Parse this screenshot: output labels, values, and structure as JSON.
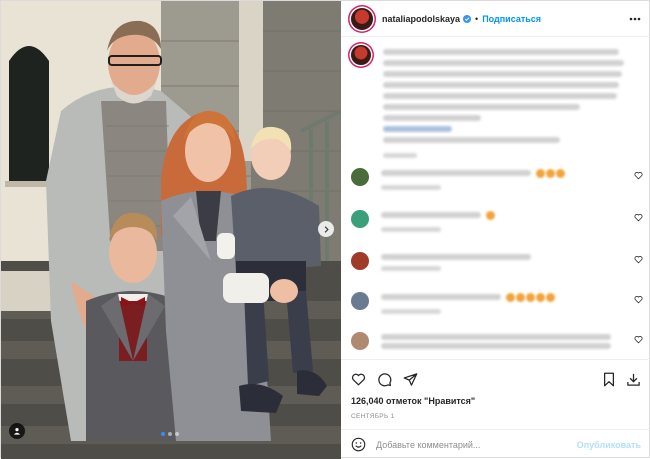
{
  "post": {
    "username": "nataliapodolskaya",
    "separator": "•",
    "follow_label": "Подписаться",
    "caption_lines": 9,
    "likes": "126,040 отметок \"Нравится\"",
    "date": "СЕНТЯБРЬ 1"
  },
  "comments": [
    {
      "avatar_color": "#4a6b3a",
      "emoji_count": 3
    },
    {
      "avatar_color": "#3aa07a",
      "emoji_count": 1
    },
    {
      "avatar_color": "#a03a2a",
      "emoji_count": 0
    },
    {
      "avatar_color": "#6a7a90",
      "emoji_count": 5
    },
    {
      "avatar_color": "#b08a70",
      "emoji_count": 0
    }
  ],
  "composer": {
    "placeholder": "Добавьте комментарий...",
    "publish_label": "Опубликовать"
  },
  "carousel": {
    "slide_count": 3,
    "active_index": 0
  },
  "colors": {
    "accent": "#0095f6",
    "story_ring": "#d1226e",
    "publish_disabled": "#b2dffc",
    "active_dot": "#2f8fff"
  },
  "icons": [
    "verified-icon",
    "more-icon",
    "heart-icon",
    "comment-icon",
    "share-icon",
    "bookmark-icon",
    "save-icon",
    "emoji-icon",
    "tag-user-icon",
    "chevron-right-icon"
  ]
}
